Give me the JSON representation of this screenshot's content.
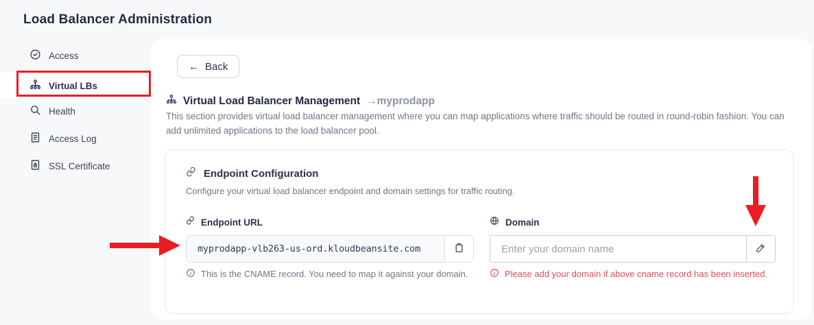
{
  "page": {
    "title": "Load Balancer Administration"
  },
  "sidebar": {
    "items": [
      {
        "label": "Access",
        "icon": "badge-check-icon",
        "active": false
      },
      {
        "label": "Virtual LBs",
        "icon": "sitemap-icon",
        "active": true
      },
      {
        "label": "Health",
        "icon": "search-icon",
        "active": false
      },
      {
        "label": "Access Log",
        "icon": "file-text-icon",
        "active": false
      },
      {
        "label": "SSL Certificate",
        "icon": "file-lock-icon",
        "active": false
      }
    ]
  },
  "main": {
    "back_arrow": "←",
    "back_label": "Back",
    "heading": {
      "title": "Virtual Load Balancer Management",
      "arrow": "→",
      "app_name": "myprodapp"
    },
    "description": "This section provides virtual load balancer management where you can map applications where traffic should be routed in round-robin fashion. You can add unlimited applications to the load balancer pool."
  },
  "endpoint_card": {
    "title": "Endpoint Configuration",
    "subtitle": "Configure your virtual load balancer endpoint and domain settings for traffic routing.",
    "endpoint": {
      "label": "Endpoint URL",
      "value": "myprodapp-vlb263-us-ord.kloudbeansite.com",
      "copy_icon": "clipboard-icon",
      "helper": "This is the CNAME record. You need to map it against your domain."
    },
    "domain": {
      "label": "Domain",
      "placeholder": "Enter your domain name",
      "edit_icon": "pencil-icon",
      "warning": "Please add your domain if above cname record has been inserted."
    }
  },
  "annotations": {
    "highlight_box_target": "Virtual LBs sidebar item",
    "arrow_right_target": "Endpoint URL field",
    "arrow_down_target": "Domain edit button",
    "color": "#ec1c24"
  },
  "colors": {
    "page_background": "#f7f8fa",
    "panel_background": "#ffffff",
    "heading_text": "#252b42",
    "muted_text": "#6e7687",
    "active_item": "#2b2a5e",
    "warning_red": "#e8485c",
    "annotation_red": "#ec1c24"
  }
}
